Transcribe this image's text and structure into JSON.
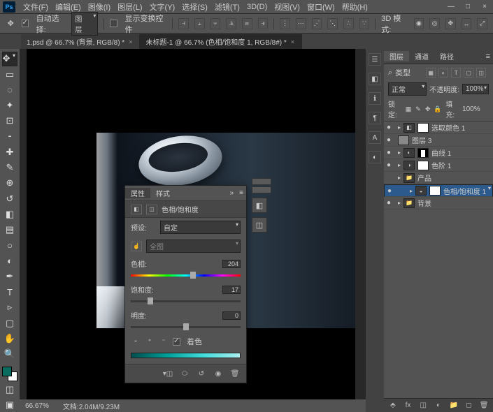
{
  "menu": [
    "文件(F)",
    "编辑(E)",
    "图像(I)",
    "图层(L)",
    "文字(Y)",
    "选择(S)",
    "滤镜(T)",
    "3D(D)",
    "视图(V)",
    "窗口(W)",
    "帮助(H)"
  ],
  "window_buttons": {
    "min": "—",
    "max": "□",
    "close": "×"
  },
  "options": {
    "auto_select": "自动选择:",
    "auto_select_value": "图层",
    "show_transform": "显示变换控件",
    "mode_3d": "3D 模式:"
  },
  "tabs": [
    {
      "label": "1.psd @ 66.7% (背景, RGB/8) *",
      "active": false
    },
    {
      "label": "未标题-1 @ 66.7% (色相/饱和度 1, RGB/8#) *",
      "active": true
    }
  ],
  "status": {
    "zoom": "66.67%",
    "doc": "文档:2.04M/9.23M"
  },
  "props": {
    "tab1": "属性",
    "tab2": "样式",
    "title": "色相/饱和度",
    "preset_label": "预设:",
    "preset_value": "自定",
    "range_value": "全图",
    "hue_label": "色相:",
    "hue_value": "204",
    "sat_label": "饱和度:",
    "sat_value": "17",
    "light_label": "明度:",
    "light_value": "0",
    "colorize": "着色"
  },
  "layerpanel": {
    "tabs": [
      "图层",
      "通道",
      "路径"
    ],
    "kind": "类型",
    "blend": "正常",
    "opacity_label": "不透明度:",
    "opacity": "100%",
    "lock_label": "锁定:",
    "fill_label": "填充:",
    "fill": "100%",
    "layers": [
      {
        "eye": "●",
        "indent": 0,
        "adj": "◧",
        "mask": "w",
        "name": "选取颜色 1"
      },
      {
        "eye": "●",
        "indent": 0,
        "thumb": "img",
        "name": "图层 3"
      },
      {
        "eye": "●",
        "indent": 0,
        "adj": "◐",
        "mask": "b",
        "name": "曲线 1"
      },
      {
        "eye": "●",
        "indent": 0,
        "adj": "◑",
        "mask": "w",
        "name": "色阶 1"
      },
      {
        "eye": "",
        "indent": 0,
        "group": true,
        "name": "产品"
      },
      {
        "eye": "●",
        "indent": 1,
        "adj": "◒",
        "mask": "w",
        "name": "色相/饱和度 1",
        "sel": true
      },
      {
        "eye": "●",
        "indent": 0,
        "folder": true,
        "name": "背景"
      }
    ]
  },
  "sideicons": [
    "☰",
    "◧",
    "ℹ",
    "¶",
    "A",
    "◐"
  ]
}
